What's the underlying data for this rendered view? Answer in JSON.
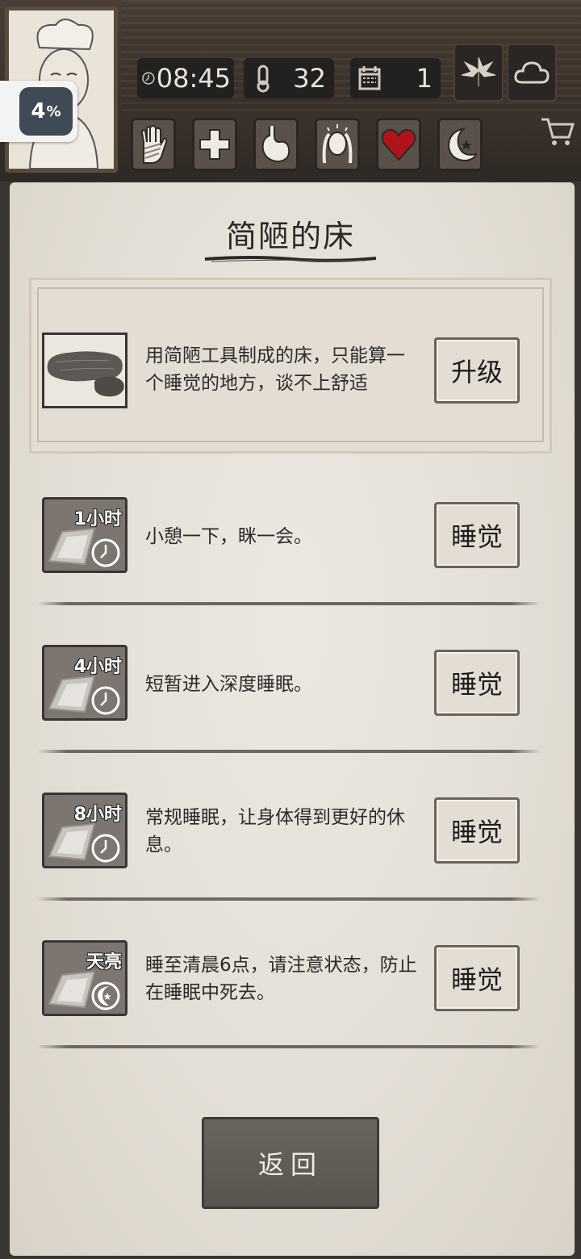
{
  "hud": {
    "battery_percent": "4",
    "battery_unit": "%",
    "time": "08:45",
    "temperature": "32",
    "day": "1"
  },
  "bed": {
    "title": "简陋的床",
    "description": "用简陋工具制成的床，只能算一个睡觉的地方，谈不上舒适",
    "upgrade_label": "升级"
  },
  "sleep_options": [
    {
      "badge": "1小时",
      "description": "小憩一下，眯一会。",
      "button_label": "睡觉"
    },
    {
      "badge": "4小时",
      "description": "短暂进入深度睡眠。",
      "button_label": "睡觉"
    },
    {
      "badge": "8小时",
      "description": "常规睡眠，让身体得到更好的休息。",
      "button_label": "睡觉"
    },
    {
      "badge": "天亮",
      "description": "睡至清晨6点，请注意状态，防止在睡眠中死去。",
      "button_label": "睡觉"
    }
  ],
  "back_label": "返回",
  "colors": {
    "parchment": "#e4dfd6",
    "wood_dark": "#2e2925",
    "heart_red": "#b0141a"
  },
  "icons": {
    "status": [
      "hand-bandage-icon",
      "plus-icon",
      "stomach-icon",
      "head-icon",
      "heart-icon",
      "moon-icon"
    ],
    "weather": [
      "leaf-icon",
      "cloud-icon"
    ],
    "stats": [
      "clock-icon",
      "thermometer-icon",
      "calendar-icon"
    ]
  }
}
